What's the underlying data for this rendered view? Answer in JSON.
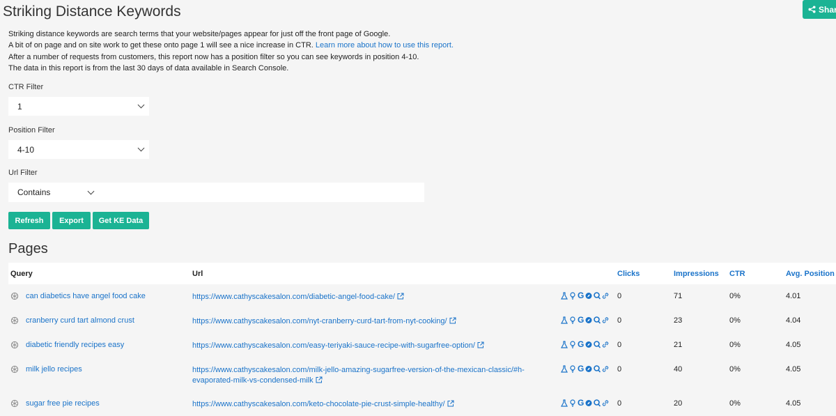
{
  "page": {
    "title": "Striking Distance Keywords",
    "share_label": "Share"
  },
  "intro": {
    "line1": "Striking distance keywords are search terms that your website/pages appear for just off the front page of Google.",
    "line2_text": "A bit of on page and on site work to get these onto page 1 will see a nice increase in CTR.",
    "line2_link": "Learn more about how to use this report.",
    "line3": "After a number of requests from customers, this report now has a position filter so you can see keywords in position 4-10.",
    "line4": "The data in this report is from the last 30 days of data available in Search Console."
  },
  "filters": {
    "ctr_label": "CTR Filter",
    "ctr_value": "1",
    "position_label": "Position Filter",
    "position_value": "4-10",
    "url_label": "Url Filter",
    "url_mode": "Contains",
    "url_value": ""
  },
  "buttons": {
    "refresh": "Refresh",
    "export": "Export",
    "get_ke": "Get KE Data"
  },
  "pages": {
    "title": "Pages",
    "columns": {
      "query": "Query",
      "url": "Url",
      "clicks": "Clicks",
      "impressions": "Impressions",
      "ctr": "CTR",
      "avg_position": "Avg. Position"
    },
    "rows": [
      {
        "query": "can diabetics have angel food cake",
        "url": "https://www.cathyscakesalon.com/diabetic-angel-food-cake/",
        "url_line2": "",
        "clicks": "0",
        "impressions": "71",
        "ctr": "0%",
        "position": "4.01"
      },
      {
        "query": "cranberry curd tart almond crust",
        "url": "https://www.cathyscakesalon.com/nyt-cranberry-curd-tart-from-nyt-cooking/",
        "url_line2": "",
        "clicks": "0",
        "impressions": "23",
        "ctr": "0%",
        "position": "4.04"
      },
      {
        "query": "diabetic friendly recipes easy",
        "url": "https://www.cathyscakesalon.com/easy-teriyaki-sauce-recipe-with-sugarfree-option/",
        "url_line2": "",
        "clicks": "0",
        "impressions": "21",
        "ctr": "0%",
        "position": "4.05"
      },
      {
        "query": "milk jello recipes",
        "url": "https://www.cathyscakesalon.com/milk-jello-amazing-sugarfree-version-of-the-mexican-classic/#h-",
        "url_line2": "evaporated-milk-vs-condensed-milk",
        "clicks": "0",
        "impressions": "40",
        "ctr": "0%",
        "position": "4.05"
      },
      {
        "query": "sugar free pie recipes",
        "url": "https://www.cathyscakesalon.com/keto-chocolate-pie-crust-simple-healthy/",
        "url_line2": "",
        "clicks": "0",
        "impressions": "20",
        "ctr": "0%",
        "position": "4.05"
      }
    ],
    "row_tools": [
      "flask-icon",
      "bulb-icon",
      "google-icon",
      "compass-icon",
      "search-q-icon",
      "link-icon"
    ]
  },
  "colors": {
    "accent": "#1bb394",
    "link": "#1a73c9",
    "background": "#f5f5f5"
  }
}
